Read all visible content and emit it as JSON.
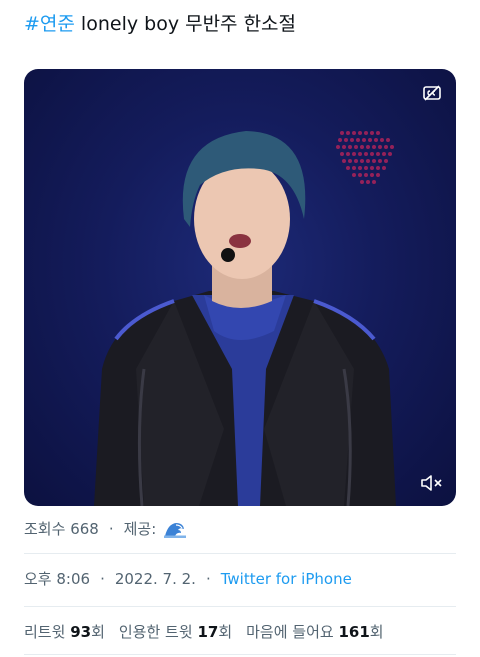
{
  "tweet": {
    "hashtag": "#연준",
    "text": " lonely boy 무반주 한소절"
  },
  "media": {
    "cc_icon": "closed-captions-off-icon",
    "mute_icon": "speaker-muted-icon"
  },
  "views": {
    "label": "조회수",
    "count": "668",
    "separator": "·",
    "provider_label": "제공:",
    "provider_icon": "wave-emoji-icon"
  },
  "timestamp": {
    "time": "오후 8:06",
    "sep1": "·",
    "date": "2022. 7. 2.",
    "sep2": "·",
    "source": "Twitter for iPhone"
  },
  "stats": {
    "retweet_label": "리트윗",
    "retweet_count": "93",
    "retweet_unit": "회",
    "quote_label": "인용한 트윗",
    "quote_count": "17",
    "quote_unit": "회",
    "like_label": "마음에 들어요",
    "like_count": "161",
    "like_unit": "회"
  },
  "colors": {
    "link": "#1d9bf0",
    "text": "#0f1419",
    "muted": "#536471",
    "media_bg": "#141c5c"
  }
}
